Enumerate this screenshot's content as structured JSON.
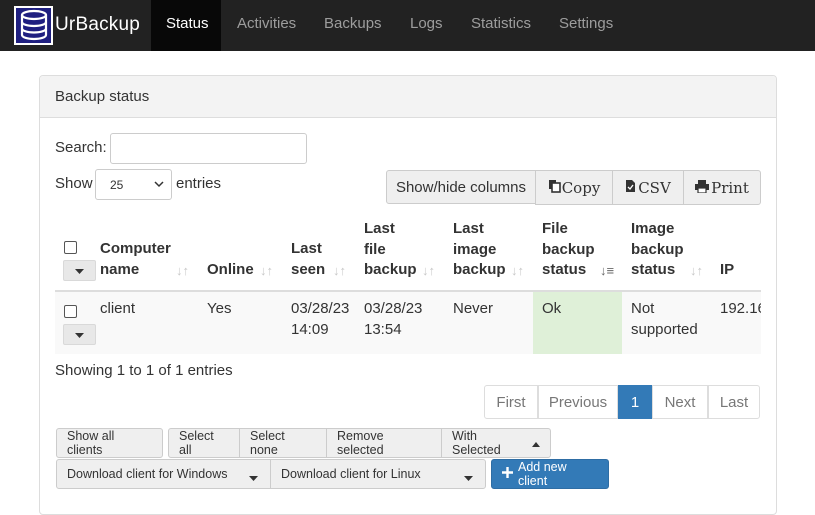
{
  "brand": {
    "name": "UrBackup"
  },
  "nav": {
    "tabs": [
      {
        "label": "Status",
        "active": true
      },
      {
        "label": "Activities"
      },
      {
        "label": "Backups"
      },
      {
        "label": "Logs"
      },
      {
        "label": "Statistics"
      },
      {
        "label": "Settings"
      }
    ]
  },
  "panel": {
    "title": "Backup status"
  },
  "controls": {
    "search_label": "Search:",
    "search_value": "",
    "show_label": "Show",
    "entries_value": "25",
    "entries_label": "entries",
    "show_hide_columns": "Show/hide columns",
    "copy": "Copy",
    "csv": "CSV",
    "print": "Print"
  },
  "table": {
    "headers": {
      "computer_name": [
        "Computer",
        "name"
      ],
      "online": [
        "Online"
      ],
      "last_seen": [
        "Last",
        "seen"
      ],
      "last_file_backup": [
        "Last",
        "file",
        "backup"
      ],
      "last_image_backup": [
        "Last",
        "image",
        "backup"
      ],
      "file_backup_status": [
        "File",
        "backup",
        "status"
      ],
      "image_backup_status": [
        "Image",
        "backup",
        "status"
      ],
      "ip": [
        "IP"
      ]
    },
    "rows": [
      {
        "computer_name": "client",
        "online": "Yes",
        "last_seen": [
          "03/28/23",
          "14:09"
        ],
        "last_file_backup": [
          "03/28/23",
          "13:54"
        ],
        "last_image_backup": "Never",
        "file_backup_status": "Ok",
        "image_backup_status": [
          "Not",
          "supported"
        ],
        "ip": "192.16"
      }
    ]
  },
  "info": {
    "text": "Showing 1 to 1 of 1 entries"
  },
  "pagination": {
    "first": "First",
    "previous": "Previous",
    "current": "1",
    "next": "Next",
    "last": "Last"
  },
  "actions": {
    "show_all_clients": "Show all clients",
    "select_all": "Select all",
    "select_none": "Select none",
    "remove_selected": "Remove selected",
    "with_selected": "With Selected",
    "download_windows": "Download client for Windows",
    "download_linux": "Download client for Linux",
    "add_new_client": "Add new client"
  },
  "colors": {
    "navbar": "#222222",
    "nav_active": "#080808",
    "primary": "#337ab7",
    "ok_cell": "#dff0d8",
    "panel_heading": "#f3f3f3"
  }
}
